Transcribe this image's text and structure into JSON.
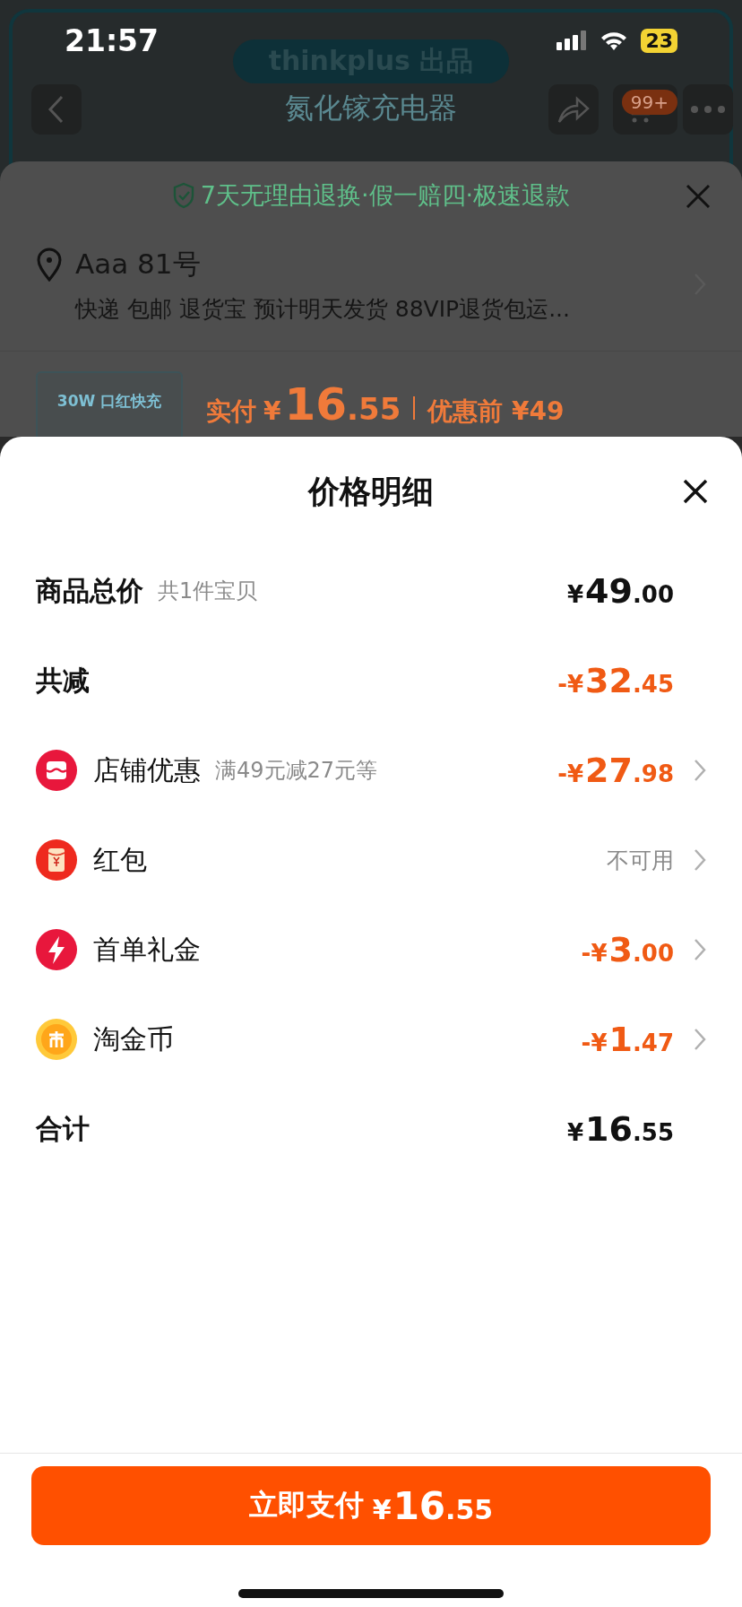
{
  "status_bar": {
    "time": "21:57",
    "battery": "23"
  },
  "product_banner": {
    "brand_badge": "thinkplus 出品",
    "subtitle": "氮化镓充电器",
    "cart_badge": "99+"
  },
  "order_sheet": {
    "guarantee": "7天无理由退换·假一赔四·极速退款",
    "address": "Aaa 81号",
    "delivery": "快递 包邮 退货宝 预计明天发货 88VIP退货包运...",
    "thumbnail_text": "30W 口红快充",
    "paid_label": "实付",
    "paid_price": {
      "currency": "¥",
      "whole": "16",
      "cents": ".55"
    },
    "original_price": "优惠前 ¥49"
  },
  "price_detail": {
    "title": "价格明细",
    "rows": [
      {
        "kind": "summary",
        "label": "商品总价",
        "note": "共1件宝贝",
        "amount": {
          "currency": "¥",
          "whole": "49",
          "cents": ".00"
        }
      },
      {
        "kind": "discount",
        "label": "共减",
        "amount": {
          "currency": "-¥",
          "whole": "32",
          "cents": ".45"
        }
      },
      {
        "kind": "store_coupon",
        "label": "店铺优惠",
        "note": "满49元减27元等",
        "amount": {
          "currency": "-¥",
          "whole": "27",
          "cents": ".98"
        }
      },
      {
        "kind": "red_packet",
        "label": "红包",
        "value": "不可用"
      },
      {
        "kind": "first_order_gift",
        "label": "首单礼金",
        "amount": {
          "currency": "-¥",
          "whole": "3",
          "cents": ".00"
        }
      },
      {
        "kind": "gold_coins",
        "label": "淘金币",
        "amount": {
          "currency": "-¥",
          "whole": "1",
          "cents": ".47"
        }
      },
      {
        "kind": "summary",
        "label": "合计",
        "amount": {
          "currency": "¥",
          "whole": "16",
          "cents": ".55"
        }
      }
    ]
  },
  "pay_button": {
    "label": "立即支付",
    "amount": {
      "currency": "¥",
      "whole": "16",
      "cents": ".55"
    }
  }
}
